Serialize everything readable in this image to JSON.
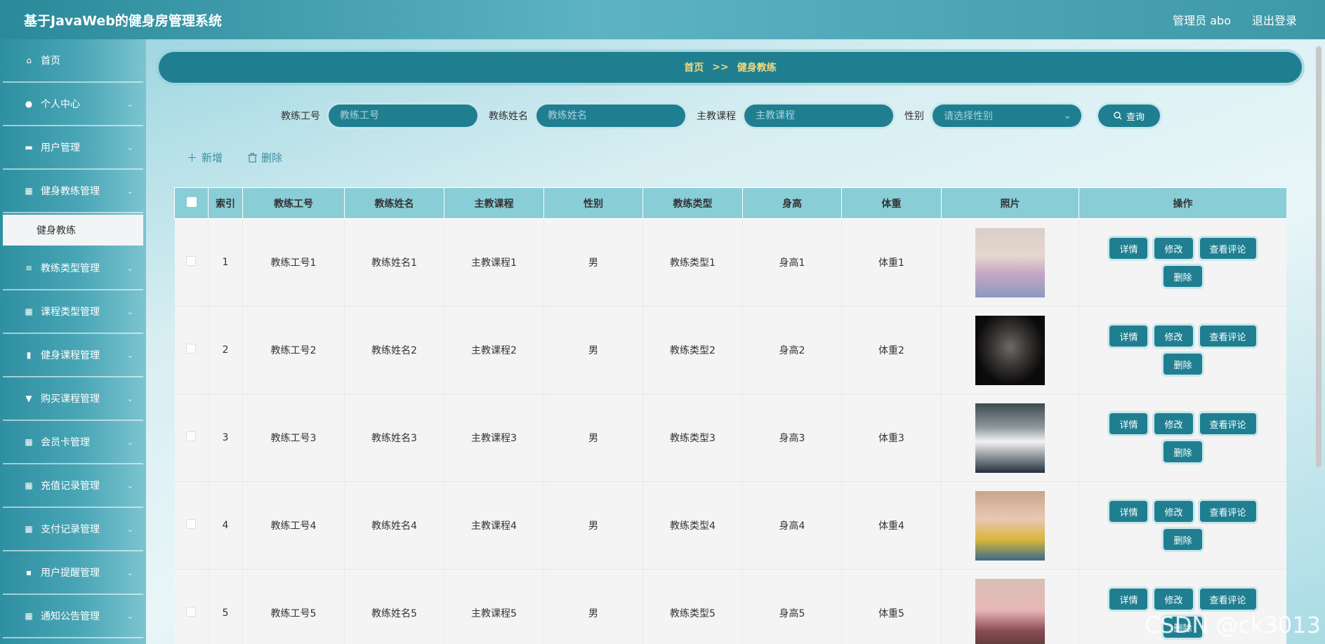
{
  "header": {
    "title": "基于JavaWeb的健身房管理系统",
    "user": "管理员 abo",
    "logout": "退出登录"
  },
  "sidebar": {
    "items": [
      {
        "label": "首页",
        "icon": "home-icon",
        "glyph": "⌂",
        "expandable": false
      },
      {
        "label": "个人中心",
        "icon": "user-icon",
        "glyph": "●",
        "expandable": true
      },
      {
        "label": "用户管理",
        "icon": "folder-icon",
        "glyph": "▬",
        "expandable": true
      },
      {
        "label": "健身教练管理",
        "icon": "grid-icon",
        "glyph": "▦",
        "expandable": true,
        "sub": "健身教练"
      },
      {
        "label": "教练类型管理",
        "icon": "sliders-icon",
        "glyph": "≡",
        "expandable": true
      },
      {
        "label": "课程类型管理",
        "icon": "grid-icon",
        "glyph": "▦",
        "expandable": true
      },
      {
        "label": "健身课程管理",
        "icon": "bar-chart-icon",
        "glyph": "▮",
        "expandable": true
      },
      {
        "label": "购买课程管理",
        "icon": "receipt-icon",
        "glyph": "▼",
        "expandable": true
      },
      {
        "label": "会员卡管理",
        "icon": "grid-icon",
        "glyph": "▦",
        "expandable": true
      },
      {
        "label": "充值记录管理",
        "icon": "grid-icon",
        "glyph": "▦",
        "expandable": true
      },
      {
        "label": "支付记录管理",
        "icon": "grid-icon",
        "glyph": "▦",
        "expandable": true
      },
      {
        "label": "用户提醒管理",
        "icon": "chat-icon",
        "glyph": "▪",
        "expandable": true
      },
      {
        "label": "通知公告管理",
        "icon": "grid-icon",
        "glyph": "▦",
        "expandable": true
      }
    ]
  },
  "breadcrumb": {
    "home": "首页",
    "sep": ">>",
    "current": "健身教练"
  },
  "search": {
    "fields": [
      {
        "label": "教练工号",
        "placeholder": "教练工号"
      },
      {
        "label": "教练姓名",
        "placeholder": "教练姓名"
      },
      {
        "label": "主教课程",
        "placeholder": "主教课程"
      }
    ],
    "gender_label": "性别",
    "gender_placeholder": "请选择性别",
    "button": "查询"
  },
  "actions": {
    "add": "新增",
    "delete": "删除"
  },
  "table": {
    "headers": [
      "索引",
      "教练工号",
      "教练姓名",
      "主教课程",
      "性别",
      "教练类型",
      "身高",
      "体重",
      "照片",
      "操作"
    ],
    "ops": [
      "详情",
      "修改",
      "查看评论",
      "删除"
    ],
    "rows": [
      {
        "index": "1",
        "no": "教练工号1",
        "name": "教练姓名1",
        "course": "主教课程1",
        "gender": "男",
        "type": "教练类型1",
        "height": "身高1",
        "weight": "体重1",
        "photo": "coach-photo-1"
      },
      {
        "index": "2",
        "no": "教练工号2",
        "name": "教练姓名2",
        "course": "主教课程2",
        "gender": "男",
        "type": "教练类型2",
        "height": "身高2",
        "weight": "体重2",
        "photo": "coach-photo-2"
      },
      {
        "index": "3",
        "no": "教练工号3",
        "name": "教练姓名3",
        "course": "主教课程3",
        "gender": "男",
        "type": "教练类型3",
        "height": "身高3",
        "weight": "体重3",
        "photo": "coach-photo-3"
      },
      {
        "index": "4",
        "no": "教练工号4",
        "name": "教练姓名4",
        "course": "主教课程4",
        "gender": "男",
        "type": "教练类型4",
        "height": "身高4",
        "weight": "体重4",
        "photo": "coach-photo-4"
      },
      {
        "index": "5",
        "no": "教练工号5",
        "name": "教练姓名5",
        "course": "主教课程5",
        "gender": "男",
        "type": "教练类型5",
        "height": "身高5",
        "weight": "体重5",
        "photo": "coach-photo-5"
      }
    ]
  },
  "watermark": "CSDN @ck3013"
}
